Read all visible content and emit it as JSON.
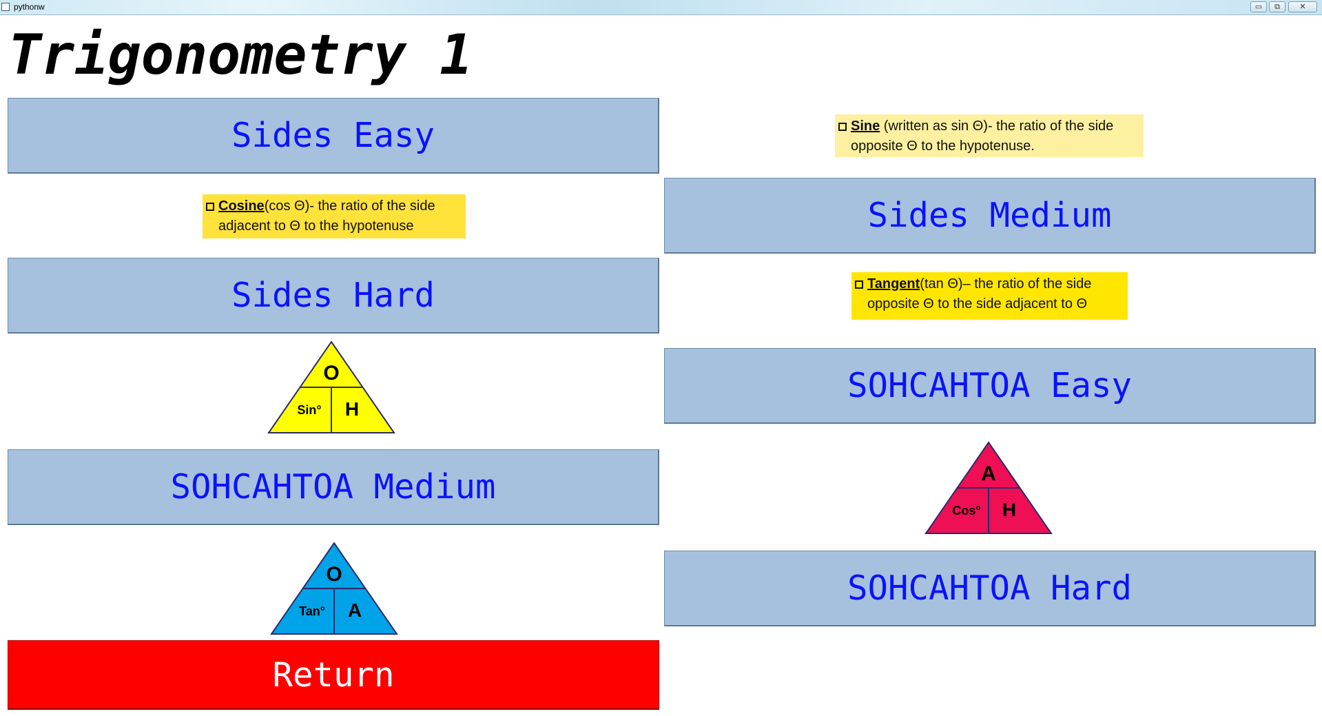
{
  "window": {
    "title": "pythonw",
    "controls": {
      "minimize": "▭",
      "restore": "⧉",
      "close": "✕"
    }
  },
  "page": {
    "title": "Trigonometry 1"
  },
  "menu": {
    "sides_easy": "Sides Easy",
    "sides_medium": "Sides Medium",
    "sides_hard": "Sides Hard",
    "sohcahtoa_easy": "SOHCAHTOA Easy",
    "sohcahtoa_medium": "SOHCAHTOA Medium",
    "sohcahtoa_hard": "SOHCAHTOA Hard",
    "return": "Return"
  },
  "definitions": {
    "sine": {
      "term": "Sine",
      "rest": " (written as sin Θ)- the ratio of the side",
      "line2": "opposite Θ to the hypotenuse."
    },
    "cosine": {
      "term": "Cosine",
      "rest": "(cos Θ)- the ratio of the side",
      "line2": "adjacent to Θ to the hypotenuse"
    },
    "tangent": {
      "term": "Tangent",
      "rest": "(tan Θ)– the ratio of the side",
      "line2": "opposite Θ to the side adjacent to Θ"
    }
  },
  "triangles": {
    "sine": {
      "top": "O",
      "left": "Sin°",
      "right": "H",
      "color": "#ffff00"
    },
    "cosine": {
      "top": "A",
      "left": "Cos°",
      "right": "H",
      "color": "#ee0f55"
    },
    "tangent": {
      "top": "O",
      "left": "Tan°",
      "right": "A",
      "color": "#00a2e8"
    }
  },
  "colors": {
    "button_bg": "#a5c1dd",
    "button_text": "#0b11ff",
    "return_bg": "#ff0000",
    "definition_bg": "#ffe23a"
  }
}
